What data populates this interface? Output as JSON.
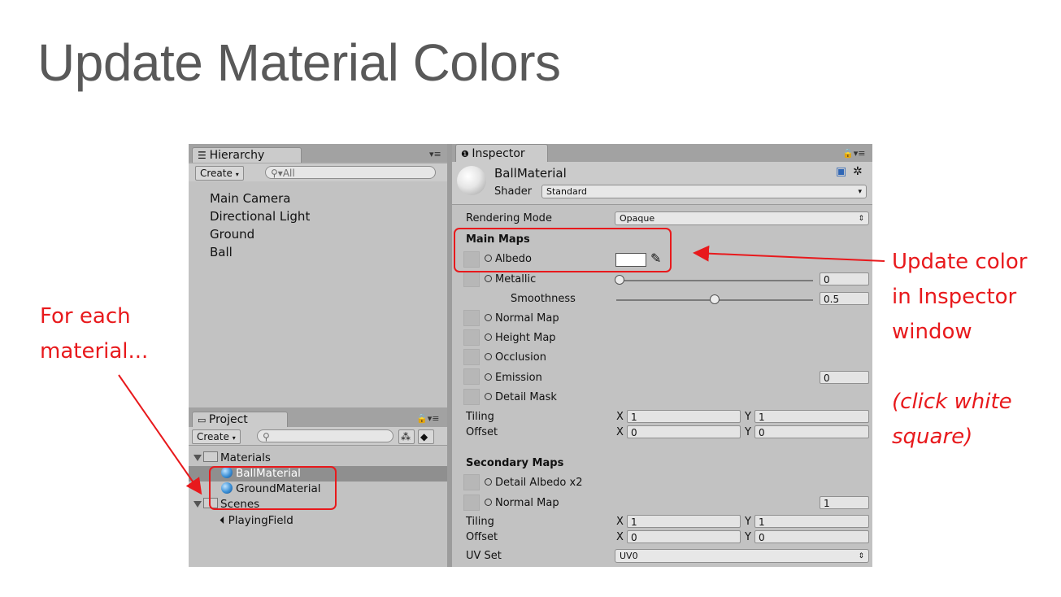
{
  "slide": {
    "title": "Update Material Colors",
    "left_note_lines": [
      "For each",
      "material..."
    ],
    "right_note_lines": [
      "Update color",
      "in Inspector",
      "window"
    ],
    "right_note_italic_lines": [
      "(click white",
      "square)"
    ],
    "accent_color": "#e8191c"
  },
  "hierarchy": {
    "tab_label": "Hierarchy",
    "create_label": "Create",
    "search_placeholder": "All",
    "items": [
      "Main Camera",
      "Directional Light",
      "Ground",
      "Ball"
    ]
  },
  "project": {
    "tab_label": "Project",
    "create_label": "Create",
    "tree": [
      {
        "label": "Materials",
        "kind": "folder"
      },
      {
        "label": "BallMaterial",
        "kind": "material",
        "selected": true
      },
      {
        "label": "GroundMaterial",
        "kind": "material"
      },
      {
        "label": "Scenes",
        "kind": "folder"
      },
      {
        "label": "PlayingField",
        "kind": "scene"
      }
    ]
  },
  "inspector": {
    "tab_label": "Inspector",
    "material_name": "BallMaterial",
    "shader_label": "Shader",
    "shader_value": "Standard",
    "rendering_mode_label": "Rendering Mode",
    "rendering_mode_value": "Opaque",
    "main_maps_label": "Main Maps",
    "albedo_label": "Albedo",
    "metallic_label": "Metallic",
    "metallic_value": "0",
    "smoothness_label": "Smoothness",
    "smoothness_value": "0.5",
    "normal_map_label": "Normal Map",
    "height_map_label": "Height Map",
    "occlusion_label": "Occlusion",
    "emission_label": "Emission",
    "emission_value": "0",
    "detail_mask_label": "Detail Mask",
    "tiling_label": "Tiling",
    "offset_label": "Offset",
    "main_tiling_x": "1",
    "main_tiling_y": "1",
    "main_offset_x": "0",
    "main_offset_y": "0",
    "x_label": "X",
    "y_label": "Y",
    "secondary_maps_label": "Secondary Maps",
    "detail_albedo_label": "Detail Albedo x2",
    "secondary_normal_label": "Normal Map",
    "secondary_normal_value": "1",
    "sec_tiling_x": "1",
    "sec_tiling_y": "1",
    "sec_offset_x": "0",
    "sec_offset_y": "0",
    "uv_set_label": "UV Set",
    "uv_set_value": "UV0"
  }
}
